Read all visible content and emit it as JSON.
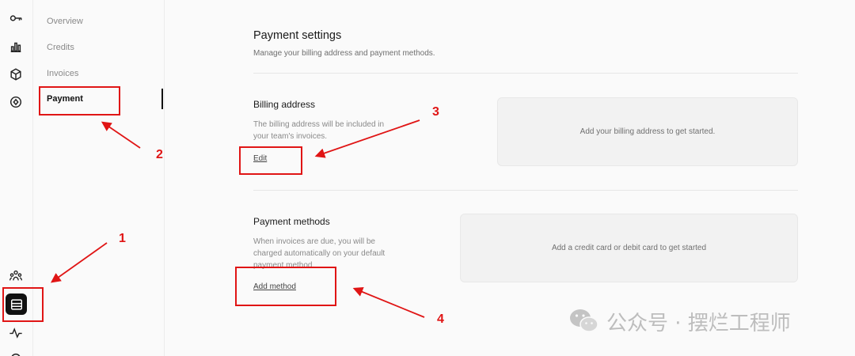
{
  "subnav": {
    "items": [
      {
        "label": "Overview"
      },
      {
        "label": "Credits"
      },
      {
        "label": "Invoices"
      },
      {
        "label": "Payment"
      }
    ]
  },
  "rail": {
    "icons": [
      "key-icon",
      "bar-chart-icon",
      "cube-icon",
      "compass-icon",
      "team-icon",
      "billing-icon",
      "activity-icon"
    ]
  },
  "page": {
    "title": "Payment settings",
    "subtitle": "Manage your billing address and payment methods."
  },
  "billing": {
    "title": "Billing address",
    "desc_line1": "The billing address will be included in",
    "desc_line2": "your team's invoices.",
    "edit_label": "Edit",
    "empty_text": "Add your billing address to get started."
  },
  "payment": {
    "title": "Payment methods",
    "desc_line1": "When invoices are due, you will be",
    "desc_line2": "charged automatically on your default",
    "desc_line3": "payment method.",
    "add_label": "Add method",
    "empty_text": "Add a credit card or debit card to get started"
  },
  "annotations": {
    "labels": [
      "1",
      "2",
      "3",
      "4"
    ],
    "color": "#e01515"
  },
  "watermark": {
    "text": "公众号 · 摆烂工程师"
  }
}
